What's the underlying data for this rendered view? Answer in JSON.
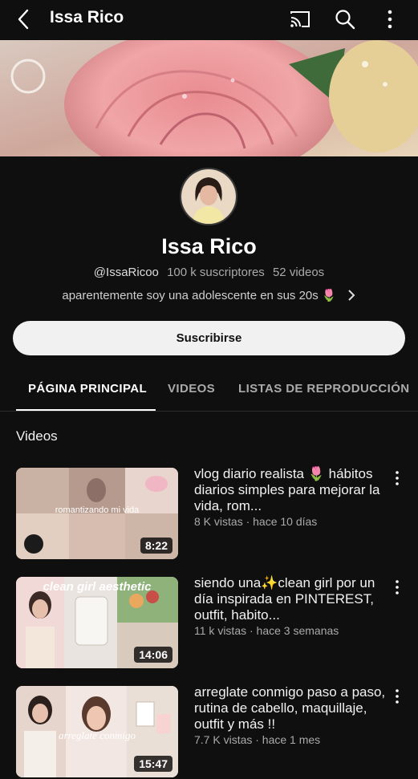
{
  "header": {
    "title": "Issa Rico",
    "icons": [
      "back-arrow-icon",
      "cast-icon",
      "search-icon",
      "more-vert-icon"
    ]
  },
  "channel": {
    "name": "Issa Rico",
    "handle": "@IssaRicoo",
    "subscribers": "100 k suscriptores",
    "video_count": "52 videos",
    "description": "aparentemente soy una adolescente en sus 20s 🌷",
    "subscribe_label": "Suscribirse"
  },
  "tabs": [
    {
      "label": "PÁGINA PRINCIPAL",
      "active": true
    },
    {
      "label": "VIDEOS",
      "active": false
    },
    {
      "label": "LISTAS DE REPRODUCCIÓN",
      "active": false
    }
  ],
  "section": {
    "title": "Videos"
  },
  "videos": [
    {
      "title": "vlog diario realista 🌷 hábitos diarios simples para mejorar la vida, rom...",
      "meta": "8 K vistas · hace 10 días",
      "duration": "8:22",
      "thumb_text": "romantizando mi vida"
    },
    {
      "title": "siendo una✨clean girl por un día inspirada en PINTEREST, outfit, habito...",
      "meta": "11 k vistas · hace 3 semanas",
      "duration": "14:06",
      "thumb_text": "clean girl aesthetic"
    },
    {
      "title": "arreglate conmigo paso a paso, rutina de cabello, maquillaje, outfit y más !!",
      "meta": "7.7 K vistas · hace 1 mes",
      "duration": "15:47",
      "thumb_text": "arreglate conmigo"
    }
  ],
  "colors": {
    "background": "#0f0f0f",
    "text": "#f1f1f1",
    "muted": "#aaaaaa",
    "subscribe_bg": "#f1f1f1"
  }
}
